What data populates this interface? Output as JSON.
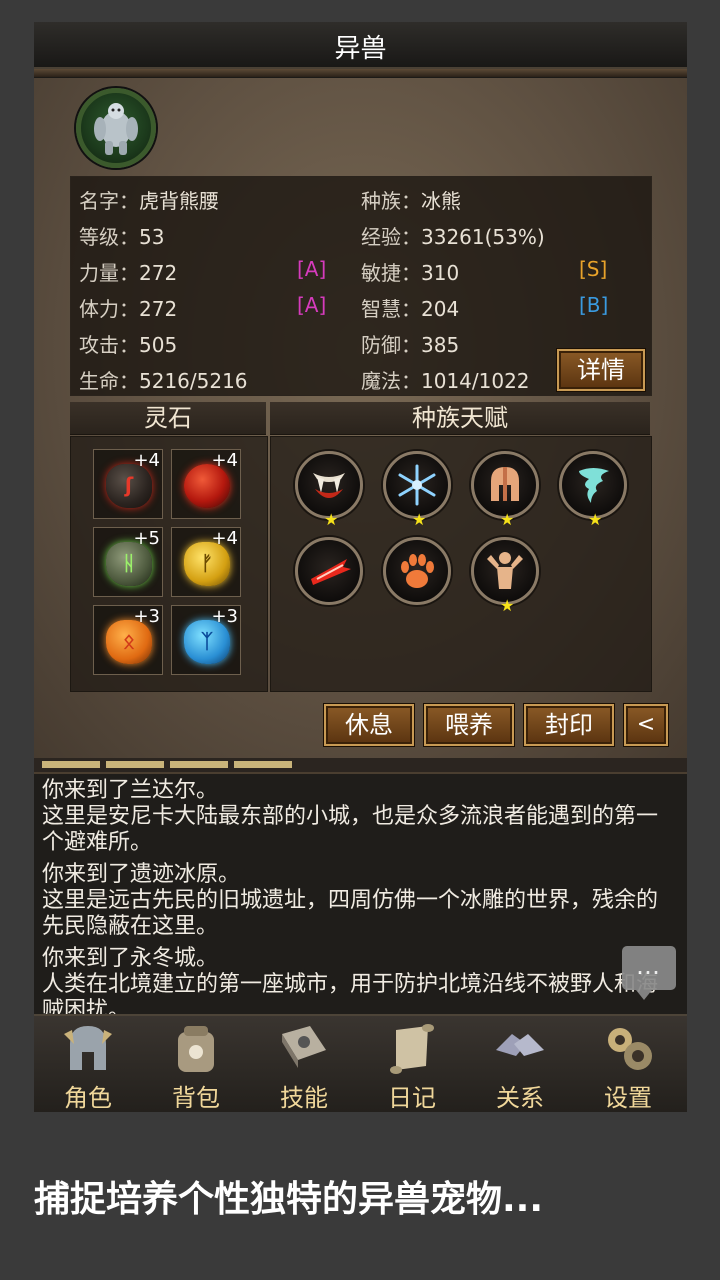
{
  "header": {
    "title": "异兽"
  },
  "pet": {
    "stats": [
      {
        "label": "名字",
        "value": "虎背熊腰"
      },
      {
        "label": "种族",
        "value": "冰熊"
      },
      {
        "label": "等级",
        "value": "53"
      },
      {
        "label": "经验",
        "value": "33261(53%)"
      },
      {
        "label": "力量",
        "value": "272",
        "grade": "[A]"
      },
      {
        "label": "敏捷",
        "value": "310",
        "grade": "[S]"
      },
      {
        "label": "体力",
        "value": "272",
        "grade": "[A]"
      },
      {
        "label": "智慧",
        "value": "204",
        "grade": "[B]"
      },
      {
        "label": "攻击",
        "value": "505"
      },
      {
        "label": "防御",
        "value": "385"
      },
      {
        "label": "生命",
        "value": "5216/5216"
      },
      {
        "label": "魔法",
        "value": "1014/1022"
      }
    ],
    "separator": "："
  },
  "buttons": {
    "detail": "详情",
    "rest": "休息",
    "feed": "喂养",
    "seal": "封印",
    "collapse": "<"
  },
  "spirit_stones": {
    "title": "灵石",
    "items": [
      {
        "plus": "+4",
        "color": "#8c1a14",
        "icon": "red-rune-stone"
      },
      {
        "plus": "+4",
        "color": "#c4261a",
        "icon": "red-orb-stone"
      },
      {
        "plus": "+5",
        "color": "#3d6b2a",
        "icon": "green-rune-stone"
      },
      {
        "plus": "+4",
        "color": "#d9a815",
        "icon": "gold-rune-stone"
      },
      {
        "plus": "+3",
        "color": "#e07a18",
        "icon": "orange-rune-stone"
      },
      {
        "plus": "+3",
        "color": "#2a8fd4",
        "icon": "blue-rune-stone"
      }
    ]
  },
  "race_talents": {
    "title": "种族天赋",
    "items": [
      {
        "icon": "fang-icon",
        "starred": true
      },
      {
        "icon": "snowflake-icon",
        "starred": true
      },
      {
        "icon": "helmet-icon",
        "starred": true
      },
      {
        "icon": "tornado-icon",
        "starred": true
      },
      {
        "icon": "slash-icon",
        "starred": false
      },
      {
        "icon": "paw-icon",
        "starred": false
      },
      {
        "icon": "strength-icon",
        "starred": true
      }
    ],
    "star_glyph": "★"
  },
  "log": {
    "paragraphs": [
      "你来到了兰达尔。\n这里是安尼卡大陆最东部的小城，也是众多流浪者能遇到的第一个避难所。",
      "你来到了遗迹冰原。\n这里是远古先民的旧城遗址，四周仿佛一个冰雕的世界，残余的先民隐蔽在这里。",
      "你来到了永冬城。\n人类在北境建立的第一座城市，用于防护北境沿线不被野人和海贼困扰。"
    ]
  },
  "chat": {
    "label": "…"
  },
  "nav": {
    "items": [
      {
        "label": "角色",
        "icon": "knight-helmet-icon"
      },
      {
        "label": "背包",
        "icon": "backpack-icon"
      },
      {
        "label": "技能",
        "icon": "spellbook-icon"
      },
      {
        "label": "日记",
        "icon": "scroll-icon"
      },
      {
        "label": "关系",
        "icon": "handshake-icon"
      },
      {
        "label": "设置",
        "icon": "gears-icon"
      }
    ]
  },
  "caption": "捕捉培养个性独特的异兽宠物..."
}
